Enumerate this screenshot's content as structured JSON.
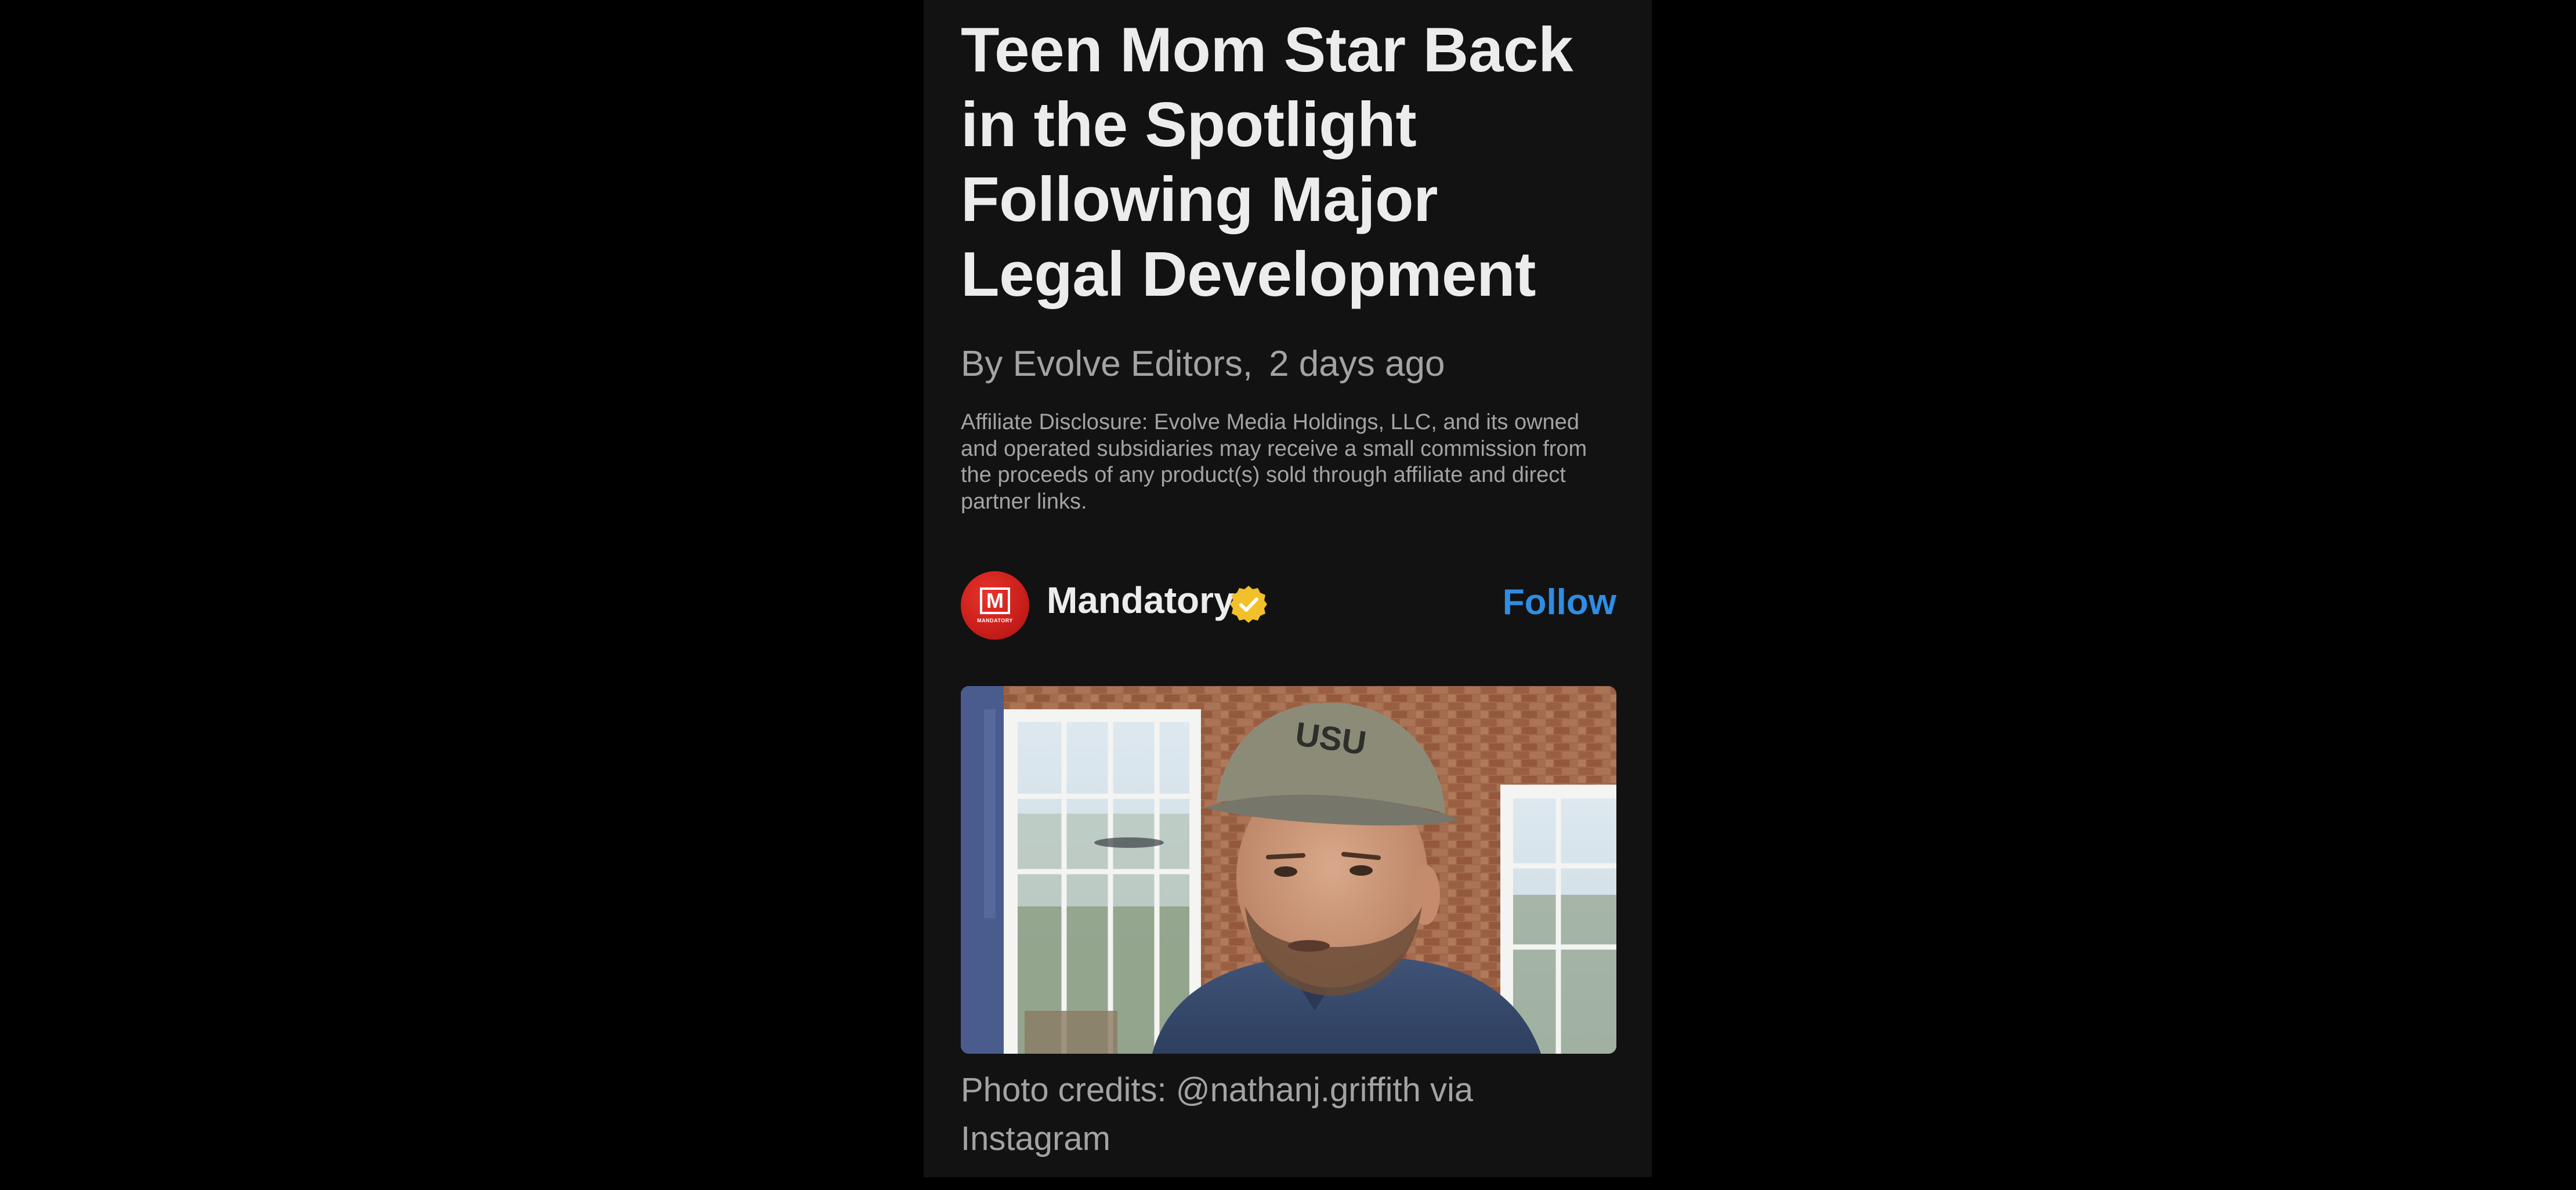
{
  "article": {
    "headline": "Teen Mom Star Back in the Spotlight Following Major Legal Development",
    "byline_author": "By Evolve Editors,",
    "byline_time": "2 days ago",
    "disclosure": "Affiliate Disclosure: Evolve Media Holdings, LLC, and its owned and operated subsidiaries may receive a small commission from the proceeds of any product(s) sold through affiliate and direct partner links."
  },
  "publisher": {
    "name": "Mandatory",
    "avatar_letter": "M",
    "avatar_wordmark": "MANDATORY",
    "verified_icon": "verified-badge-icon",
    "follow_label": "Follow"
  },
  "photo": {
    "cap_text": "USU",
    "caption": "Photo credits: @nathanj.griffith via Instagram"
  },
  "colors": {
    "page_background": "#000000",
    "card_background": "#121212",
    "headline": "#ececec",
    "secondary_text": "#a3a3a3",
    "accent": "#2f8de4",
    "publisher_brand": "#d7241f",
    "verified_badge": "#f2c02b"
  }
}
